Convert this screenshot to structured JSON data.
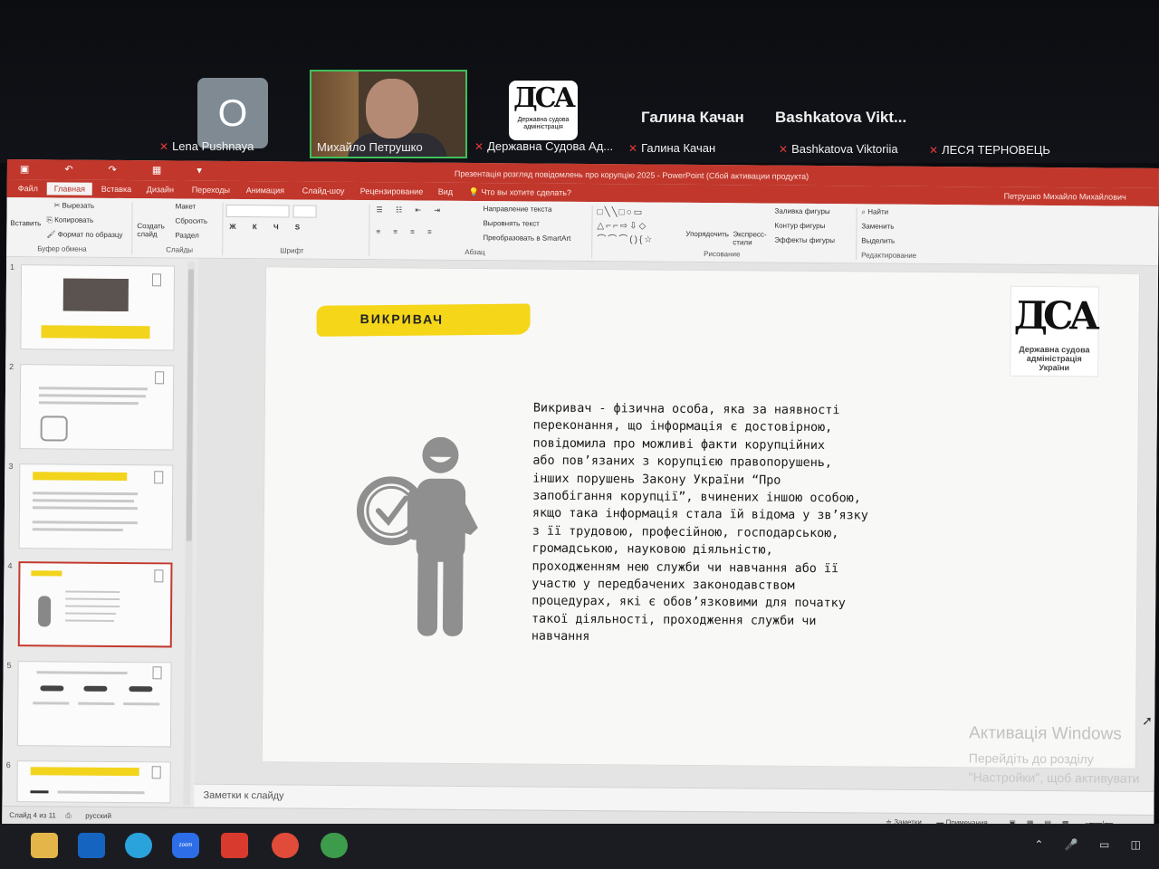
{
  "zoom": {
    "participants": [
      {
        "name": "Lena Pushnaya",
        "initial": "O",
        "muted": true
      },
      {
        "name": "Михайло Петрушко",
        "muted": false,
        "video": true
      },
      {
        "name": "Державна Судова Ад...",
        "muted": true,
        "logo_caption": "Державна судова адміністрація"
      },
      {
        "name": "Галина Качан",
        "big_label": "Галина Качан",
        "muted": true
      },
      {
        "name": "Bashkatova Viktoriia",
        "big_label": "Bashkatova  Vikt...",
        "muted": true
      },
      {
        "name": "ЛЕСЯ ТЕРНОВЕЦЬ",
        "muted": true
      }
    ],
    "mic_muted_icon": "✕"
  },
  "window": {
    "title": "Презентація розгляд повідомлень про корупцію 2025 - PowerPoint (Сбой активации продукта)",
    "user": "Петрушко Михайло Михайлович"
  },
  "ribbon": {
    "tabs": [
      "Файл",
      "Главная",
      "Вставка",
      "Дизайн",
      "Переходы",
      "Анимация",
      "Слайд-шоу",
      "Рецензирование",
      "Вид"
    ],
    "active_tab": "Главная",
    "tell_me": "Что вы хотите сделать?",
    "clipboard": {
      "paste": "Вставить",
      "cut": "Вырезать",
      "copy": "Копировать",
      "format_painter": "Формат по образцу",
      "label": "Буфер обмена"
    },
    "slides": {
      "new_slide": "Создать слайд",
      "layout": "Макет",
      "reset": "Сбросить",
      "section": "Раздел",
      "label": "Слайды"
    },
    "font": {
      "label": "Шрифт"
    },
    "paragraph": {
      "text_direction": "Направление текста",
      "align_text": "Выровнять текст",
      "smartart": "Преобразовать в SmartArt",
      "label": "Абзац"
    },
    "drawing": {
      "arrange": "Упорядочить",
      "quick_styles": "Экспресс-стили",
      "fill": "Заливка фигуры",
      "outline": "Контур фигуры",
      "effects": "Эффекты фигуры",
      "label": "Рисование"
    },
    "editing": {
      "find": "Найти",
      "replace": "Заменить",
      "select": "Выделить",
      "label": "Редактирование"
    }
  },
  "slide": {
    "title": "ВИКРИВАЧ",
    "body": "Викривач - фізична особа, яка за наявності\nпереконання, що інформація є достовірною,\nповідомила про можливі факти корупційних\nабо пов’язаних з корупцією правопорушень,\nінших порушень Закону України “Про\nзапобігання корупції”, вчинених іншою особою,\nякщо така інформація стала їй відома у зв’язку\nз її трудовою, професійною, господарською,\nгромадською, науковою діяльністю,\nпроходженням нею служби чи навчання або її\nучастю у передбачених законодавством\nпроцедурах, які є обов’язковими для початку\nтакої діяльності, проходження служби чи\nнавчання",
    "logo_caption": "Державна судова адміністрація України"
  },
  "thumbnails": {
    "numbers": [
      "1",
      "2",
      "3",
      "4",
      "5",
      "6"
    ],
    "selected": 4
  },
  "notes_placeholder": "Заметки к слайду",
  "watermark": {
    "line1": "Активація Windows",
    "line2": "Перейдіть до розділу \"Настройки\", щоб активувати Windows."
  },
  "status": {
    "slide_info": "Слайд 4 из 11",
    "language": "русский",
    "notes_btn": "Заметки",
    "comments_btn": "Примечания"
  }
}
